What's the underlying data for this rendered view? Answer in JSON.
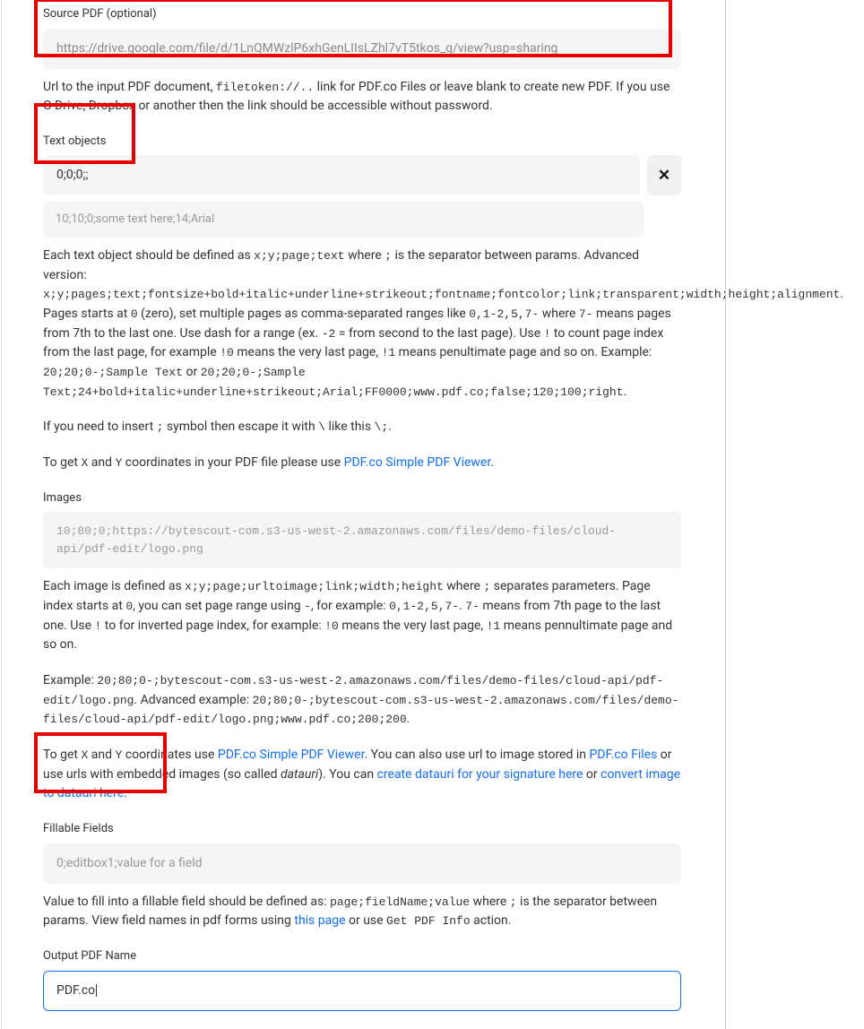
{
  "sourcePdf": {
    "label": "Source PDF (optional)",
    "value": "https://drive.google.com/file/d/1LnQMWzlP6xhGenLIIsLZhl7vT5tkos_q/view?usp=sharing",
    "desc_prefix": "Url to the input PDF document, ",
    "desc_code": "filetoken://..",
    "desc_suffix": " link for PDF.co Files or leave blank to create new PDF. If you use G Drive, Dropbox or another then the link should be accessible without password."
  },
  "textObjects": {
    "label": "Text objects",
    "value": "0;0;0;;",
    "preview": "10;10;0;some text here;14;Arial",
    "desc_p1_a": "Each text object should be defined as ",
    "desc_p1_code1": "x;y;page;text",
    "desc_p1_b": " where ",
    "desc_p1_code2": ";",
    "desc_p1_c": " is the separator between params. Advanced version: ",
    "desc_p1_code3": "x;y;pages;text;fontsize+bold+italic+underline+strikeout;fontname;fontcolor;link;transparent;width;height;alignment",
    "desc_p1_d": ". Pages starts at ",
    "desc_p1_code4": "0",
    "desc_p1_e": " (zero), set multiple pages as comma-separated ranges like ",
    "desc_p1_code5": "0,1-2,5,7-",
    "desc_p1_f": " where ",
    "desc_p1_code6": "7-",
    "desc_p1_g": " means pages from 7th to the last one. Use dash for a range (ex. ",
    "desc_p1_code7": "-2",
    "desc_p1_h": " = from second to the last page). Use ",
    "desc_p1_code8": "!",
    "desc_p1_i": " to count page index from the last page, for example ",
    "desc_p1_code9": "!0",
    "desc_p1_j": " means the very last page, ",
    "desc_p1_code10": "!1",
    "desc_p1_k": " means penultimate page and so on. Example: ",
    "desc_p1_code11": "20;20;0-;Sample Text",
    "desc_p1_l": " or ",
    "desc_p1_code12": "20;20;0-;Sample Text;24+bold+italic+underline+strikeout;Arial;FF0000;www.pdf.co;false;120;100;right",
    "desc_p1_m": ".",
    "desc_p2_a": "If you need to insert ",
    "desc_p2_code1": ";",
    "desc_p2_b": " symbol then escape it with ",
    "desc_p2_code2": "\\",
    "desc_p2_c": " like this ",
    "desc_p2_code3": "\\;",
    "desc_p2_d": ".",
    "desc_p3_a": "To get ",
    "desc_p3_code1": "X",
    "desc_p3_b": " and ",
    "desc_p3_code2": "Y",
    "desc_p3_c": " coordinates in your PDF file please use ",
    "desc_p3_link": "PDF.co Simple PDF Viewer",
    "desc_p3_d": "."
  },
  "images": {
    "label": "Images",
    "placeholder": "10;80;0;https://bytescout-com.s3-us-west-2.amazonaws.com/files/demo-files/cloud-api/pdf-edit/logo.png",
    "desc_p1_a": "Each image is defined as ",
    "desc_p1_code1": "x;y;page;urltoimage;link;width;height",
    "desc_p1_b": " where ",
    "desc_p1_code2": ";",
    "desc_p1_c": " separates parameters. Page index starts at ",
    "desc_p1_code3": "0",
    "desc_p1_d": ", you can set page range using ",
    "desc_p1_code4": "-",
    "desc_p1_e": ", for example: ",
    "desc_p1_code5": "0,1-2,5,7-",
    "desc_p1_f": ". ",
    "desc_p1_code6": "7-",
    "desc_p1_g": " means from 7th page to the last one. Use ",
    "desc_p1_code7": "!",
    "desc_p1_h": " to for inverted page index, for example: ",
    "desc_p1_code8": "!0",
    "desc_p1_i": " means the very last page, ",
    "desc_p1_code9": "!1",
    "desc_p1_j": " means pennultimate page and so on.",
    "desc_p2_a": "Example: ",
    "desc_p2_code1": "20;80;0-;bytescout-com.s3-us-west-2.amazonaws.com/files/demo-files/cloud-api/pdf-edit/logo.png",
    "desc_p2_b": ". Advanced example: ",
    "desc_p2_code2": "20;80;0-;bytescout-com.s3-us-west-2.amazonaws.com/files/demo-files/cloud-api/pdf-edit/logo.png;www.pdf.co;200;200",
    "desc_p2_c": ".",
    "desc_p3_a": "To get ",
    "desc_p3_code1": "X",
    "desc_p3_b": " and ",
    "desc_p3_code2": "Y",
    "desc_p3_c": " coordinates use ",
    "desc_p3_link1": "PDF.co Simple PDF Viewer",
    "desc_p3_d": ". You can also use url to image stored in ",
    "desc_p3_link2": "PDF.co Files",
    "desc_p3_e": " or use urls with embedded images (so called ",
    "desc_p3_em": "datauri",
    "desc_p3_f": "). You can ",
    "desc_p3_link3": "create datauri for your signature here",
    "desc_p3_g": " or ",
    "desc_p3_link4": "convert image to datauri here",
    "desc_p3_h": "."
  },
  "fillableFields": {
    "label": "Fillable Fields",
    "placeholder": "0;editbox1;value for a field",
    "desc_a": "Value to fill into a fillable field should be defined as: ",
    "desc_code1": "page;fieldName;value",
    "desc_b": " where ",
    "desc_code2": ";",
    "desc_c": " is the separator between params. View field names in pdf forms using ",
    "desc_link": "this page",
    "desc_d": " or use ",
    "desc_code3": "Get PDF Info",
    "desc_e": " action."
  },
  "outputPdfName": {
    "label": "Output PDF Name",
    "value": "PDF.co"
  },
  "xBtn": "✕"
}
